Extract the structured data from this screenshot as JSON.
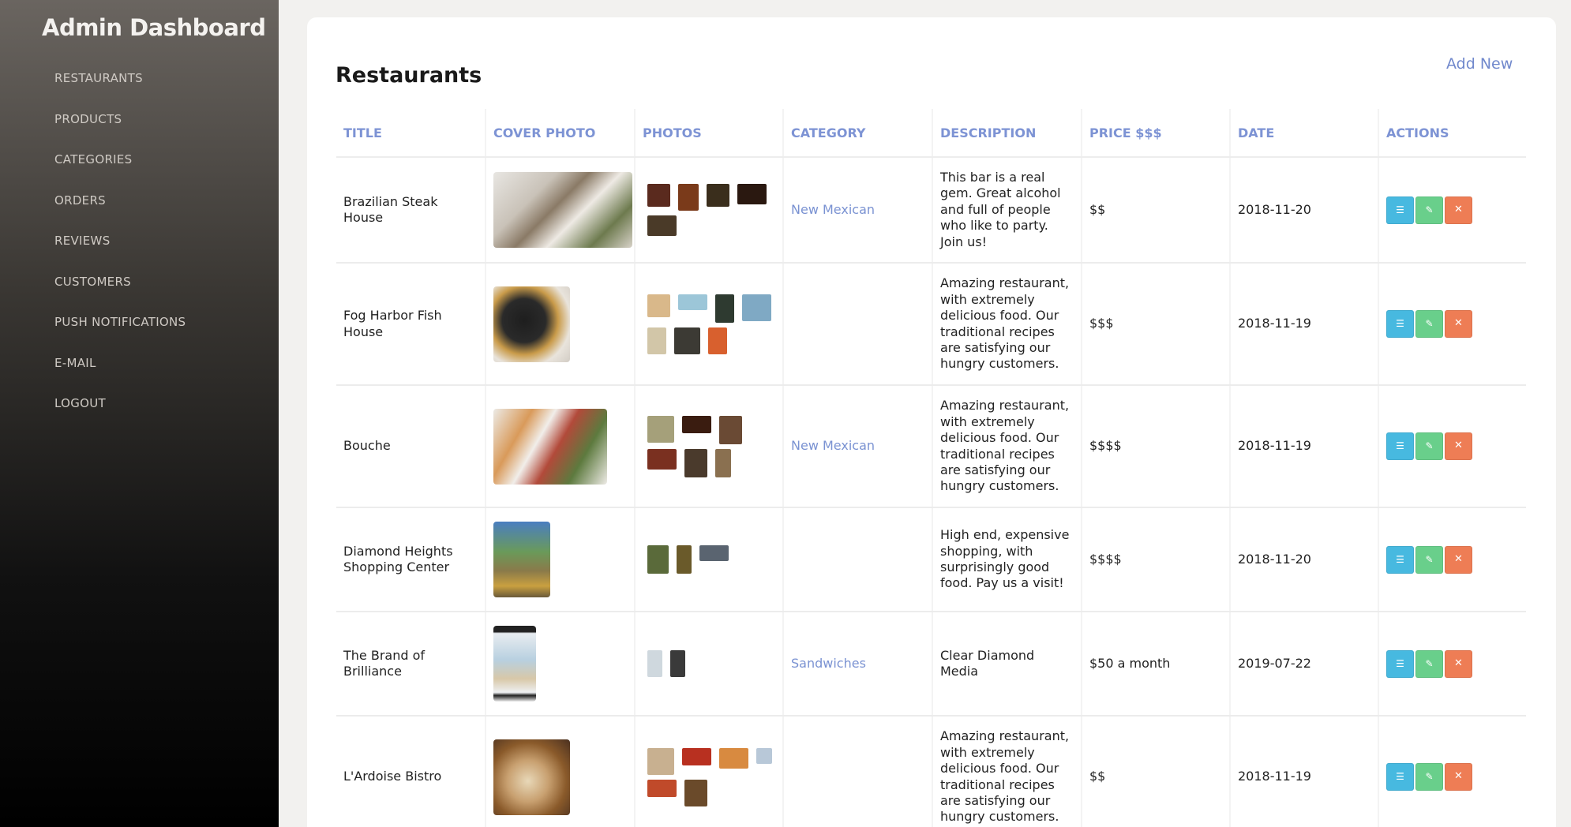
{
  "sidebar": {
    "brand": "Admin Dashboard",
    "items": [
      {
        "label": "RESTAURANTS"
      },
      {
        "label": "PRODUCTS"
      },
      {
        "label": "CATEGORIES"
      },
      {
        "label": "ORDERS"
      },
      {
        "label": "REVIEWS"
      },
      {
        "label": "CUSTOMERS"
      },
      {
        "label": "PUSH NOTIFICATIONS"
      },
      {
        "label": "E-MAIL"
      },
      {
        "label": "LOGOUT"
      }
    ]
  },
  "page": {
    "title": "Restaurants",
    "add_new_label": "Add New"
  },
  "table": {
    "headers": {
      "title": "TITLE",
      "cover_photo": "COVER PHOTO",
      "photos": "PHOTOS",
      "category": "CATEGORY",
      "description": "DESCRIPTION",
      "price": "PRICE $$$",
      "date": "DATE",
      "actions": "ACTIONS"
    },
    "rows": [
      {
        "title": "Brazilian Steak House",
        "category": "New Mexican",
        "description": "This bar is a real gem. Great alcohol and full of people who like to party. Join us!",
        "price": "$$",
        "date": "2018-11-20"
      },
      {
        "title": "Fog Harbor Fish House",
        "category": "",
        "description": "Amazing restaurant, with extremely delicious food. Our traditional recipes are satisfying our hungry customers.",
        "price": "$$$",
        "date": "2018-11-19"
      },
      {
        "title": "Bouche",
        "category": "New Mexican",
        "description": "Amazing restaurant, with extremely delicious food. Our traditional recipes are satisfying our hungry customers.",
        "price": "$$$$",
        "date": "2018-11-19"
      },
      {
        "title": "Diamond Heights Shopping Center",
        "category": "",
        "description": "High end, expensive shopping, with surprisingly good food. Pay us a visit!",
        "price": "$$$$",
        "date": "2018-11-20"
      },
      {
        "title": "The Brand of Brilliance",
        "category": "Sandwiches",
        "description": "Clear Diamond Media",
        "price": "$50 a month",
        "date": "2019-07-22"
      },
      {
        "title": "L'Ardoise Bistro",
        "category": "",
        "description": "Amazing restaurant, with extremely delicious food. Our traditional recipes are satisfying our hungry customers.",
        "price": "$$",
        "date": "2018-11-19"
      }
    ]
  },
  "icons": {
    "list": "list-icon",
    "edit": "edit-icon",
    "delete": "close-icon"
  },
  "colors": {
    "accent": "#7d93d4",
    "btn_list": "#47b9e0",
    "btn_edit": "#69cf8b",
    "btn_delete": "#ee7d55"
  }
}
